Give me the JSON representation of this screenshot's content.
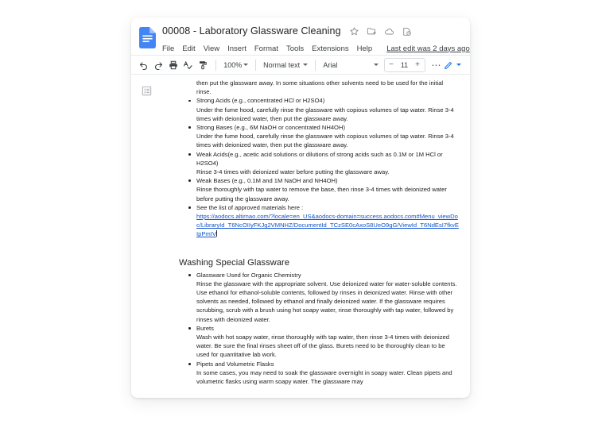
{
  "window": {
    "app": "Google Docs"
  },
  "header": {
    "logo_icon": "google-docs-icon",
    "doc_title": "00008 - Laboratory Glassware Cleaning",
    "title_icons": [
      {
        "name": "star-icon",
        "label": "Star"
      },
      {
        "name": "move-to-folder-icon",
        "label": "Move"
      },
      {
        "name": "cloud-saved-icon",
        "label": "See document status"
      },
      {
        "name": "document-history-icon",
        "label": "Document history"
      }
    ],
    "menu_items": [
      "File",
      "Edit",
      "View",
      "Insert",
      "Format",
      "Tools",
      "Extensions",
      "Help"
    ],
    "last_edit": "Last edit was 2 days ago"
  },
  "toolbar": {
    "buttons": [
      {
        "name": "undo-icon",
        "label": "Undo"
      },
      {
        "name": "redo-icon",
        "label": "Redo"
      },
      {
        "name": "print-icon",
        "label": "Print"
      },
      {
        "name": "spellcheck-icon",
        "label": "Spelling and grammar check"
      },
      {
        "name": "paint-format-icon",
        "label": "Paint format"
      }
    ],
    "zoom": "100%",
    "paragraph_style": "Normal text",
    "font_family": "Arial",
    "font_size": "11",
    "font_size_decrease": "−",
    "font_size_increase": "+",
    "more_label": "⋯",
    "mode_icon": "edit-pencil-icon",
    "mode_label": "Editing"
  },
  "sidebar": {
    "outline_icon": "document-outline-icon"
  },
  "document": {
    "continued_paragraph": "then put the glassware away. In some situations other solvents need to be used for the initial rinse.",
    "bullets_top": [
      {
        "title": "Strong Acids (e.g., concentrated HCl or H2SO4)",
        "body": "Under the fume hood, carefully rinse the glassware with copious volumes of tap water. Rinse 3-4 times with deionized water, then put the glassware away."
      },
      {
        "title": "Strong Bases (e.g., 6M NaOH or concentrated NH4OH)",
        "body": "Under the fume hood, carefully rinse the glassware with copious volumes of tap water. Rinse 3-4 times with deionized water, then put the glassware away."
      },
      {
        "title": "Weak Acids(e.g., acetic acid solutions or dilutions of strong acids such as 0.1M or 1M HCl or H2SO4)",
        "body": "Rinse 3-4 times with deionized water before putting the glassware away."
      },
      {
        "title": "Weak Bases (e.g., 0.1M and 1M NaOH and NH4OH)",
        "body": "Rinse thoroughly with tap water to remove the base, then rinse 3-4 times with deionized water before putting the glassware away."
      }
    ],
    "approved_materials_label": "See the list of approved materials here :",
    "approved_materials_link": "https://aodocs.altirnao.com/?locale=en_US&aodocs-domain=success.aodocs.com#Menu_viewDoc/LibraryId_T6NcOIIyFKJg2VMNHZ/DocumentId_TCzSE0cAxoS8UeO9gG/ViewId_T6NdEsI7fkvEIpPmIV",
    "section_heading": "Washing Special Glassware",
    "bullets_bottom": [
      {
        "title": "Glassware Used for Organic Chemistry",
        "body": "Rinse the glassware with the appropriate solvent. Use deionized water for water-soluble contents. Use ethanol for ethanol-soluble contents, followed by rinses in deionized water. Rinse with other solvents as needed, followed by ethanol and finally deionized water. If the glassware requires scrubbing, scrub with a brush using hot soapy water, rinse thoroughly with tap water, followed by rinses with deionized water."
      },
      {
        "title": "Burets",
        "body": "Wash with hot soapy water, rinse thoroughly with tap water, then rinse 3-4 times with deionized water. Be sure the final rinses sheet off of the glass. Burets need to be thoroughly clean to be used for quantitative lab work."
      },
      {
        "title": "Pipets and Volumetric Flasks",
        "body": "In some cases, you may need to soak the glassware overnight in soapy water. Clean pipets and volumetric flasks using warm soapy water. The glassware may"
      }
    ]
  },
  "colors": {
    "link": "#1155cc",
    "text": "#202124",
    "brand_blue": "#4285f4",
    "border": "#e8eaed"
  }
}
